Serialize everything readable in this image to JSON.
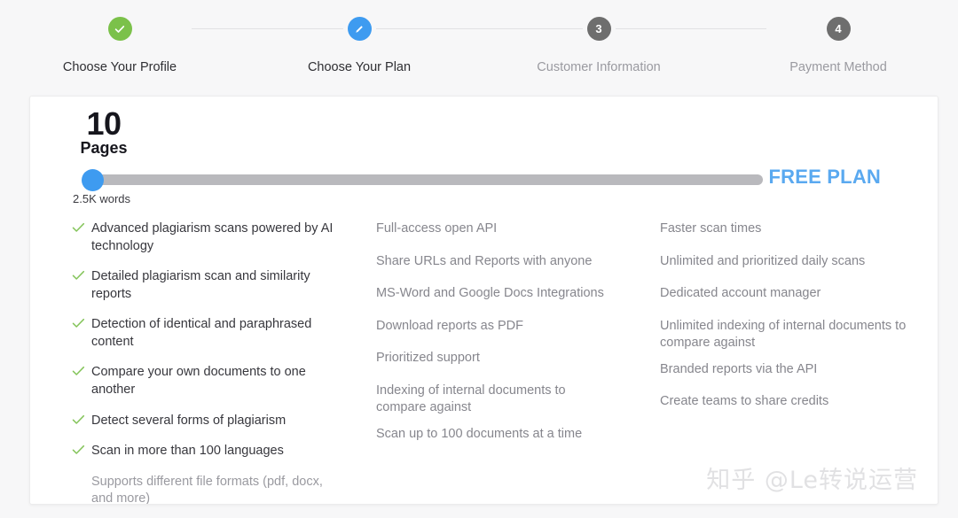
{
  "stepper": {
    "steps": [
      {
        "label": "Choose Your Profile",
        "marker": "check",
        "state": "done",
        "icon_name": "check-icon"
      },
      {
        "label": "Choose Your Plan",
        "marker": "pencil",
        "state": "current",
        "icon_name": "pencil-icon"
      },
      {
        "label": "Customer Information",
        "marker": "3",
        "state": "pending",
        "icon_name": "step-number-3"
      },
      {
        "label": "Payment Method",
        "marker": "4",
        "state": "pending",
        "icon_name": "step-number-4"
      }
    ]
  },
  "plan": {
    "pages_count": "10",
    "pages_word": "Pages",
    "words_label": "2.5K words",
    "plan_name": "FREE PLAN",
    "slider": {
      "value": 0,
      "min": 0,
      "max": 100,
      "thumb_color": "#3e9bf0",
      "track_color": "#b9b9bd"
    }
  },
  "colors": {
    "accent_blue": "#3e9bf0",
    "plan_blue": "#5aa9f0",
    "check_green": "#7bc14a",
    "done_green": "#7bc14a",
    "pending_gray": "#6e6e6e",
    "muted_text": "#9a9aa0"
  },
  "features": {
    "column_1": [
      {
        "text": "Advanced plagiarism scans powered by AI technology",
        "included": true
      },
      {
        "text": "Detailed plagiarism scan and similarity reports",
        "included": true
      },
      {
        "text": "Detection of identical and paraphrased content",
        "included": true
      },
      {
        "text": "Compare your own documents to one another",
        "included": true
      },
      {
        "text": "Detect several forms of plagiarism",
        "included": true
      },
      {
        "text": "Scan in more than 100 languages",
        "included": true
      },
      {
        "text": "Supports different file formats (pdf, docx, and more)",
        "included": false
      }
    ],
    "column_2": [
      {
        "text": "Full-access open API",
        "included": false
      },
      {
        "text": "Share URLs and Reports with anyone",
        "included": false
      },
      {
        "text": "MS-Word and Google Docs Integrations",
        "included": false
      },
      {
        "text": "Download reports as PDF",
        "included": false
      },
      {
        "text": "Prioritized support",
        "included": false
      },
      {
        "text": "Indexing of internal documents to compare against",
        "included": false
      },
      {
        "text": "Scan up to 100 documents at a time",
        "included": false
      }
    ],
    "column_3": [
      {
        "text": "Faster scan times",
        "included": false
      },
      {
        "text": "Unlimited and prioritized daily scans",
        "included": false
      },
      {
        "text": "Dedicated account manager",
        "included": false
      },
      {
        "text": "Unlimited indexing of internal documents to compare against",
        "included": false
      },
      {
        "text": "Branded reports via the API",
        "included": false
      },
      {
        "text": "Create teams to share credits",
        "included": false
      }
    ]
  },
  "watermark": {
    "text": "知乎 @Le转说运营"
  }
}
